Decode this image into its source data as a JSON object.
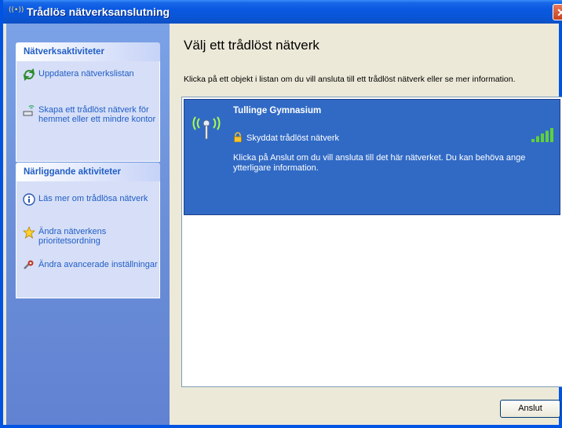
{
  "window": {
    "title": "Trådlös nätverksanslutning",
    "close_glyph": "✕"
  },
  "sidebar": {
    "network_tasks": {
      "header": "Nätverksaktiviteter",
      "items": [
        {
          "label": "Uppdatera nätverkslistan",
          "icon": "refresh-icon"
        },
        {
          "label": "Skapa ett trådlöst nätverk för hemmet eller ett mindre kontor",
          "icon": "setup-network-icon"
        }
      ]
    },
    "related_tasks": {
      "header": "Närliggande aktiviteter",
      "items": [
        {
          "label": "Läs mer om trådlösa nätverk",
          "icon": "info-icon"
        },
        {
          "label": "Ändra nätverkens prioritetsordning",
          "icon": "star-icon"
        },
        {
          "label": "Ändra avancerade inställningar",
          "icon": "settings-icon"
        }
      ]
    }
  },
  "main": {
    "title": "Välj ett trådlöst nätverk",
    "hint": "Klicka på ett objekt i listan om du vill ansluta till ett trådlöst nätverk eller se mer information.",
    "networks": [
      {
        "name": "Tullinge Gymnasium",
        "security": "Skyddat trådlöst nätverk",
        "description": "Klicka på Anslut om du vill ansluta till det här nätverket. Du kan behöva ange ytterligare information.",
        "signal_bars": 5,
        "selected": true
      }
    ],
    "connect_button": "Anslut"
  },
  "colors": {
    "titlebar": "#0a58e0",
    "selection": "#316ac5",
    "task_link": "#215dc6",
    "signal": "#5fd13a"
  }
}
